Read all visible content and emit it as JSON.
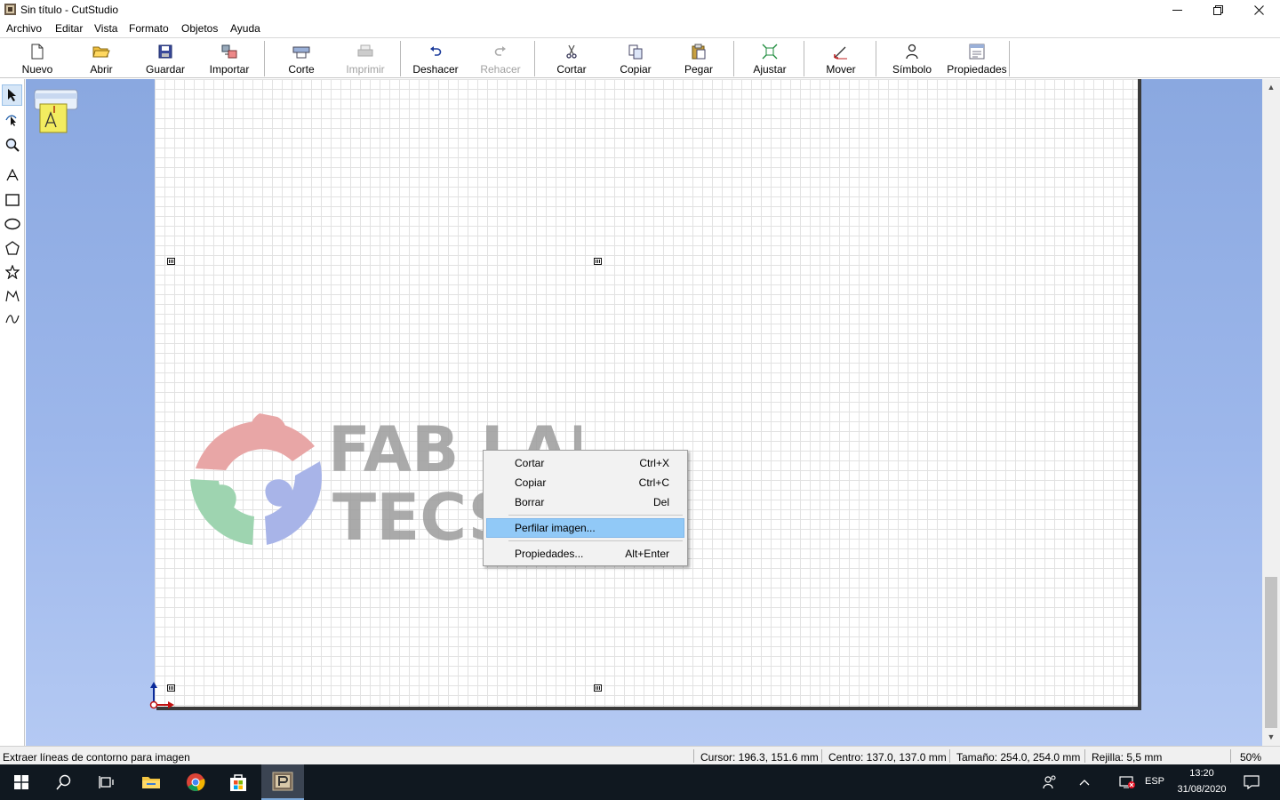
{
  "window": {
    "title": "Sin título - CutStudio",
    "minimize_glyph": "—",
    "maximize_glyph": "❐",
    "close_glyph": "✕"
  },
  "menu": [
    "Archivo",
    "Editar",
    "Vista",
    "Formato",
    "Objetos",
    "Ayuda"
  ],
  "toolbar": {
    "buttons": [
      {
        "label": "Nuevo",
        "icon": "new-document-icon",
        "enabled": true
      },
      {
        "label": "Abrir",
        "icon": "open-folder-icon",
        "enabled": true
      },
      {
        "label": "Guardar",
        "icon": "save-disk-icon",
        "enabled": true
      },
      {
        "label": "Importar",
        "icon": "import-icon",
        "enabled": true
      },
      {
        "label": "Corte",
        "icon": "cut-plotter-icon",
        "enabled": true
      },
      {
        "label": "Imprimir",
        "icon": "printer-icon",
        "enabled": false
      },
      {
        "label": "Deshacer",
        "icon": "undo-icon",
        "enabled": true
      },
      {
        "label": "Rehacer",
        "icon": "redo-icon",
        "enabled": false
      },
      {
        "label": "Cortar",
        "icon": "scissors-icon",
        "enabled": true
      },
      {
        "label": "Copiar",
        "icon": "copy-icon",
        "enabled": true
      },
      {
        "label": "Pegar",
        "icon": "paste-icon",
        "enabled": true
      },
      {
        "label": "Ajustar",
        "icon": "fit-icon",
        "enabled": true
      },
      {
        "label": "Mover",
        "icon": "move-icon",
        "enabled": true
      },
      {
        "label": "Símbolo",
        "icon": "symbol-person-icon",
        "enabled": true
      },
      {
        "label": "Propiedades",
        "icon": "properties-icon",
        "enabled": true
      }
    ]
  },
  "tools": [
    "select-arrow-icon",
    "node-edit-icon",
    "zoom-icon",
    "text-tool-icon",
    "rectangle-tool-icon",
    "ellipse-tool-icon",
    "polygon-tool-icon",
    "star-tool-icon",
    "polyline-tool-icon",
    "curve-tool-icon"
  ],
  "logo": {
    "line1": "FAB LAB",
    "line2": "TECS"
  },
  "context_menu": {
    "items": [
      {
        "label": "Cortar",
        "shortcut": "Ctrl+X"
      },
      {
        "label": "Copiar",
        "shortcut": "Ctrl+C"
      },
      {
        "label": "Borrar",
        "shortcut": "Del"
      },
      {
        "label": "Perfilar imagen...",
        "shortcut": "",
        "highlighted": true
      },
      {
        "label": "Propiedades...",
        "shortcut": "Alt+Enter"
      }
    ]
  },
  "status": {
    "hint": "Extraer líneas de contorno para imagen",
    "cursor": "Cursor: 196.3, 151.6 mm",
    "center": "Centro: 137.0, 137.0 mm",
    "size": "Tamaño: 254.0, 254.0 mm",
    "grid": "Rejilla: 5,5 mm",
    "zoom": "50%"
  },
  "taskbar": {
    "lang": "ESP",
    "time": "13:20",
    "date": "31/08/2020"
  },
  "colors": {
    "workspace_top": "#8aa8e0",
    "workspace_bottom": "#b4c9f3",
    "menu_highlight": "#91c9f7",
    "taskbar": "#101820"
  }
}
